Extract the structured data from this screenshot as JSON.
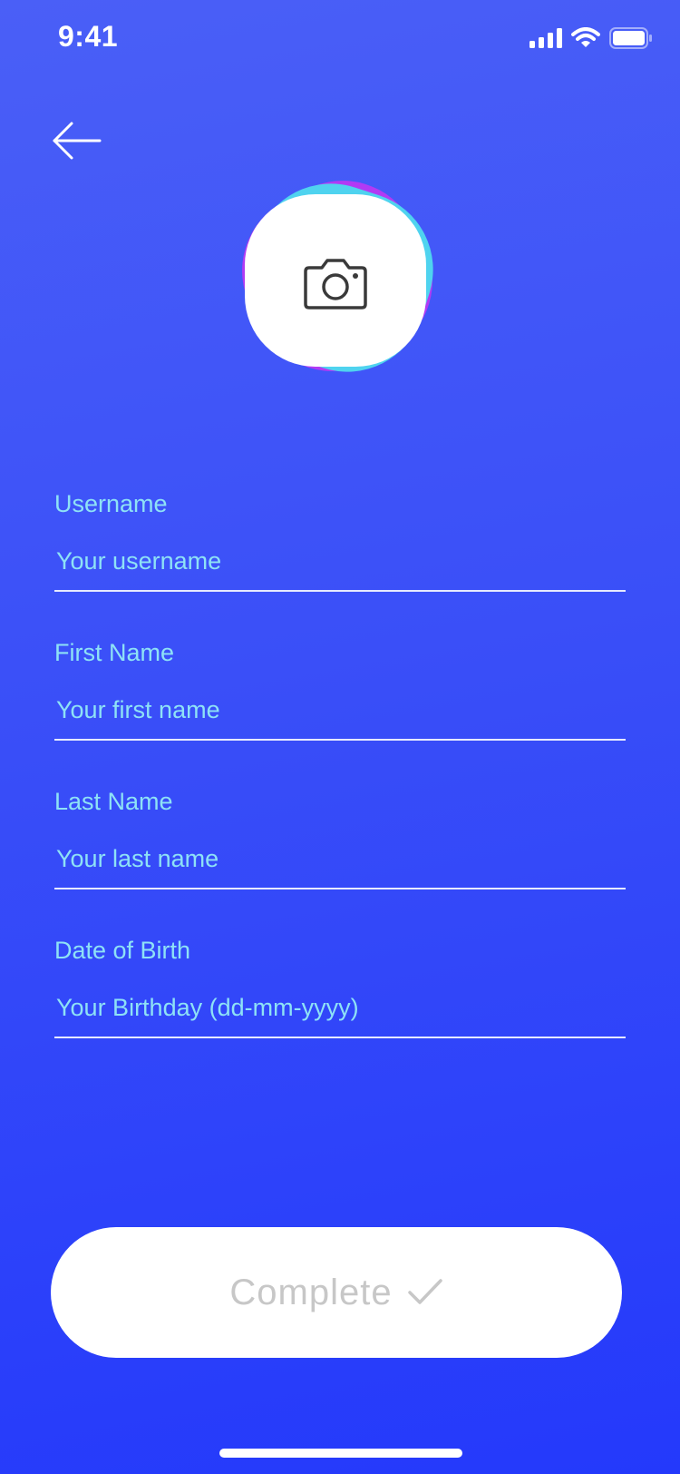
{
  "status_bar": {
    "time": "9:41",
    "icons": [
      "cellular-signal-icon",
      "wifi-icon",
      "battery-icon"
    ]
  },
  "header": {
    "back_icon": "arrow-left-icon"
  },
  "avatar": {
    "icon": "camera-icon"
  },
  "form": {
    "fields": [
      {
        "label": "Username",
        "placeholder": "Your username",
        "value": ""
      },
      {
        "label": "First Name",
        "placeholder": "Your first name",
        "value": ""
      },
      {
        "label": "Last Name",
        "placeholder": "Your last name",
        "value": ""
      },
      {
        "label": "Date of Birth",
        "placeholder": "Your Birthday (dd-mm-yyyy)",
        "value": ""
      }
    ]
  },
  "complete_button": {
    "label": "Complete",
    "icon": "checkmark-icon"
  },
  "colors": {
    "background_top": "#4a5ff7",
    "background_bottom": "#2439fb",
    "label_text": "#8ee2f6",
    "avatar_cyan": "#4fd3ef",
    "avatar_purple": "#b23af4",
    "button_text": "#c7c7c7"
  }
}
